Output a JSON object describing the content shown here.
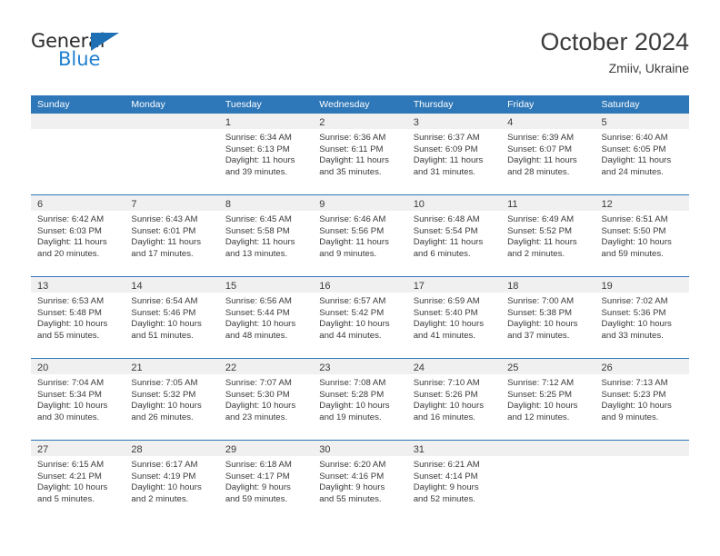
{
  "brand": {
    "name_primary": "General",
    "name_secondary": "Blue",
    "triangle_icon": "triangle-icon",
    "accent_color": "#1f7fd0"
  },
  "header": {
    "title": "October 2024",
    "subtitle": "Zmiiv, Ukraine"
  },
  "colors": {
    "header_blue": "#2e77b8",
    "date_band_gray": "#f0f0f0",
    "text": "#3a3a3a"
  },
  "weekdays": [
    "Sunday",
    "Monday",
    "Tuesday",
    "Wednesday",
    "Thursday",
    "Friday",
    "Saturday"
  ],
  "weeks": [
    [
      {
        "day": "",
        "sunrise": "",
        "sunset": "",
        "daylight_1": "",
        "daylight_2": ""
      },
      {
        "day": "",
        "sunrise": "",
        "sunset": "",
        "daylight_1": "",
        "daylight_2": ""
      },
      {
        "day": "1",
        "sunrise": "Sunrise: 6:34 AM",
        "sunset": "Sunset: 6:13 PM",
        "daylight_1": "Daylight: 11 hours",
        "daylight_2": "and 39 minutes."
      },
      {
        "day": "2",
        "sunrise": "Sunrise: 6:36 AM",
        "sunset": "Sunset: 6:11 PM",
        "daylight_1": "Daylight: 11 hours",
        "daylight_2": "and 35 minutes."
      },
      {
        "day": "3",
        "sunrise": "Sunrise: 6:37 AM",
        "sunset": "Sunset: 6:09 PM",
        "daylight_1": "Daylight: 11 hours",
        "daylight_2": "and 31 minutes."
      },
      {
        "day": "4",
        "sunrise": "Sunrise: 6:39 AM",
        "sunset": "Sunset: 6:07 PM",
        "daylight_1": "Daylight: 11 hours",
        "daylight_2": "and 28 minutes."
      },
      {
        "day": "5",
        "sunrise": "Sunrise: 6:40 AM",
        "sunset": "Sunset: 6:05 PM",
        "daylight_1": "Daylight: 11 hours",
        "daylight_2": "and 24 minutes."
      }
    ],
    [
      {
        "day": "6",
        "sunrise": "Sunrise: 6:42 AM",
        "sunset": "Sunset: 6:03 PM",
        "daylight_1": "Daylight: 11 hours",
        "daylight_2": "and 20 minutes."
      },
      {
        "day": "7",
        "sunrise": "Sunrise: 6:43 AM",
        "sunset": "Sunset: 6:01 PM",
        "daylight_1": "Daylight: 11 hours",
        "daylight_2": "and 17 minutes."
      },
      {
        "day": "8",
        "sunrise": "Sunrise: 6:45 AM",
        "sunset": "Sunset: 5:58 PM",
        "daylight_1": "Daylight: 11 hours",
        "daylight_2": "and 13 minutes."
      },
      {
        "day": "9",
        "sunrise": "Sunrise: 6:46 AM",
        "sunset": "Sunset: 5:56 PM",
        "daylight_1": "Daylight: 11 hours",
        "daylight_2": "and 9 minutes."
      },
      {
        "day": "10",
        "sunrise": "Sunrise: 6:48 AM",
        "sunset": "Sunset: 5:54 PM",
        "daylight_1": "Daylight: 11 hours",
        "daylight_2": "and 6 minutes."
      },
      {
        "day": "11",
        "sunrise": "Sunrise: 6:49 AM",
        "sunset": "Sunset: 5:52 PM",
        "daylight_1": "Daylight: 11 hours",
        "daylight_2": "and 2 minutes."
      },
      {
        "day": "12",
        "sunrise": "Sunrise: 6:51 AM",
        "sunset": "Sunset: 5:50 PM",
        "daylight_1": "Daylight: 10 hours",
        "daylight_2": "and 59 minutes."
      }
    ],
    [
      {
        "day": "13",
        "sunrise": "Sunrise: 6:53 AM",
        "sunset": "Sunset: 5:48 PM",
        "daylight_1": "Daylight: 10 hours",
        "daylight_2": "and 55 minutes."
      },
      {
        "day": "14",
        "sunrise": "Sunrise: 6:54 AM",
        "sunset": "Sunset: 5:46 PM",
        "daylight_1": "Daylight: 10 hours",
        "daylight_2": "and 51 minutes."
      },
      {
        "day": "15",
        "sunrise": "Sunrise: 6:56 AM",
        "sunset": "Sunset: 5:44 PM",
        "daylight_1": "Daylight: 10 hours",
        "daylight_2": "and 48 minutes."
      },
      {
        "day": "16",
        "sunrise": "Sunrise: 6:57 AM",
        "sunset": "Sunset: 5:42 PM",
        "daylight_1": "Daylight: 10 hours",
        "daylight_2": "and 44 minutes."
      },
      {
        "day": "17",
        "sunrise": "Sunrise: 6:59 AM",
        "sunset": "Sunset: 5:40 PM",
        "daylight_1": "Daylight: 10 hours",
        "daylight_2": "and 41 minutes."
      },
      {
        "day": "18",
        "sunrise": "Sunrise: 7:00 AM",
        "sunset": "Sunset: 5:38 PM",
        "daylight_1": "Daylight: 10 hours",
        "daylight_2": "and 37 minutes."
      },
      {
        "day": "19",
        "sunrise": "Sunrise: 7:02 AM",
        "sunset": "Sunset: 5:36 PM",
        "daylight_1": "Daylight: 10 hours",
        "daylight_2": "and 33 minutes."
      }
    ],
    [
      {
        "day": "20",
        "sunrise": "Sunrise: 7:04 AM",
        "sunset": "Sunset: 5:34 PM",
        "daylight_1": "Daylight: 10 hours",
        "daylight_2": "and 30 minutes."
      },
      {
        "day": "21",
        "sunrise": "Sunrise: 7:05 AM",
        "sunset": "Sunset: 5:32 PM",
        "daylight_1": "Daylight: 10 hours",
        "daylight_2": "and 26 minutes."
      },
      {
        "day": "22",
        "sunrise": "Sunrise: 7:07 AM",
        "sunset": "Sunset: 5:30 PM",
        "daylight_1": "Daylight: 10 hours",
        "daylight_2": "and 23 minutes."
      },
      {
        "day": "23",
        "sunrise": "Sunrise: 7:08 AM",
        "sunset": "Sunset: 5:28 PM",
        "daylight_1": "Daylight: 10 hours",
        "daylight_2": "and 19 minutes."
      },
      {
        "day": "24",
        "sunrise": "Sunrise: 7:10 AM",
        "sunset": "Sunset: 5:26 PM",
        "daylight_1": "Daylight: 10 hours",
        "daylight_2": "and 16 minutes."
      },
      {
        "day": "25",
        "sunrise": "Sunrise: 7:12 AM",
        "sunset": "Sunset: 5:25 PM",
        "daylight_1": "Daylight: 10 hours",
        "daylight_2": "and 12 minutes."
      },
      {
        "day": "26",
        "sunrise": "Sunrise: 7:13 AM",
        "sunset": "Sunset: 5:23 PM",
        "daylight_1": "Daylight: 10 hours",
        "daylight_2": "and 9 minutes."
      }
    ],
    [
      {
        "day": "27",
        "sunrise": "Sunrise: 6:15 AM",
        "sunset": "Sunset: 4:21 PM",
        "daylight_1": "Daylight: 10 hours",
        "daylight_2": "and 5 minutes."
      },
      {
        "day": "28",
        "sunrise": "Sunrise: 6:17 AM",
        "sunset": "Sunset: 4:19 PM",
        "daylight_1": "Daylight: 10 hours",
        "daylight_2": "and 2 minutes."
      },
      {
        "day": "29",
        "sunrise": "Sunrise: 6:18 AM",
        "sunset": "Sunset: 4:17 PM",
        "daylight_1": "Daylight: 9 hours",
        "daylight_2": "and 59 minutes."
      },
      {
        "day": "30",
        "sunrise": "Sunrise: 6:20 AM",
        "sunset": "Sunset: 4:16 PM",
        "daylight_1": "Daylight: 9 hours",
        "daylight_2": "and 55 minutes."
      },
      {
        "day": "31",
        "sunrise": "Sunrise: 6:21 AM",
        "sunset": "Sunset: 4:14 PM",
        "daylight_1": "Daylight: 9 hours",
        "daylight_2": "and 52 minutes."
      },
      {
        "day": "",
        "sunrise": "",
        "sunset": "",
        "daylight_1": "",
        "daylight_2": ""
      },
      {
        "day": "",
        "sunrise": "",
        "sunset": "",
        "daylight_1": "",
        "daylight_2": ""
      }
    ]
  ]
}
